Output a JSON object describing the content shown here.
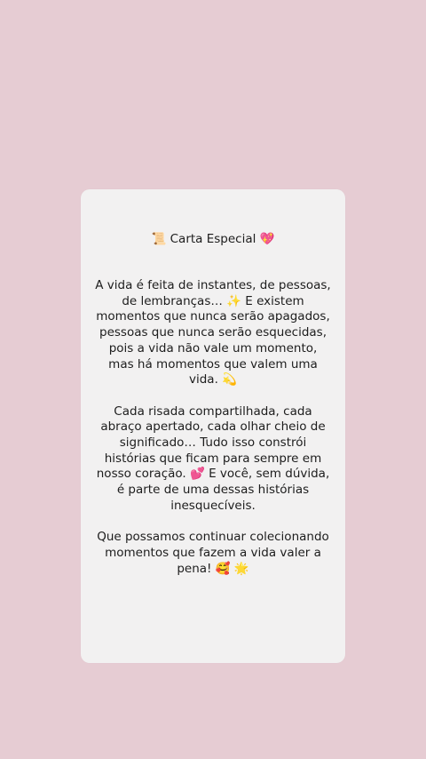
{
  "card": {
    "title": "📜 Carta Especial 💖",
    "paragraphs": [
      "A vida é feita de instantes, de pessoas, de lembranças… ✨ E existem momentos que nunca serão apagados, pessoas que nunca serão esquecidas, pois a vida não vale um momento, mas há momentos que valem uma vida. 💫",
      "Cada risada compartilhada, cada abraço apertado, cada olhar cheio de significado… Tudo isso constrói histórias que ficam para sempre em nosso coração. 💕 E você, sem dúvida, é parte de uma dessas histórias inesquecíveis.",
      "Que possamos continuar colecionando momentos que fazem a vida valer a pena! 🥰 🌟"
    ]
  },
  "colors": {
    "background": "#e6ccd3",
    "card": "#f2f1f1",
    "text": "#1d1d1d"
  }
}
